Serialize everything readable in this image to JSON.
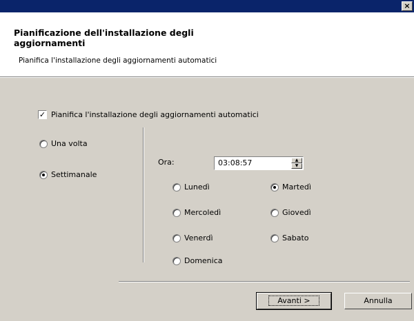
{
  "window": {
    "close_symbol": "×"
  },
  "header": {
    "title": "Pianificazione dell'installazione degli aggiornamenti",
    "subtitle": "Pianifica l'installazione degli aggiornamenti automatici"
  },
  "schedule_checkbox": {
    "label": "Pianifica l'installazione degli aggiornamenti automatici",
    "checked": true,
    "mark": "✓"
  },
  "frequency": [
    {
      "label": "Una volta",
      "selected": false
    },
    {
      "label": "Settimanale",
      "selected": true
    }
  ],
  "time": {
    "label": "Ora:",
    "value": "03:08:57",
    "up": "▲",
    "down": "▼"
  },
  "days": [
    {
      "label": "Lunedì",
      "selected": false
    },
    {
      "label": "Martedì",
      "selected": true
    },
    {
      "label": "Mercoledì",
      "selected": false
    },
    {
      "label": "Giovedì",
      "selected": false
    },
    {
      "label": "Venerdì",
      "selected": false
    },
    {
      "label": "Sabato",
      "selected": false
    },
    {
      "label": "Domenica",
      "selected": false
    }
  ],
  "buttons": {
    "next": "Avanti >",
    "cancel": "Annulla"
  }
}
